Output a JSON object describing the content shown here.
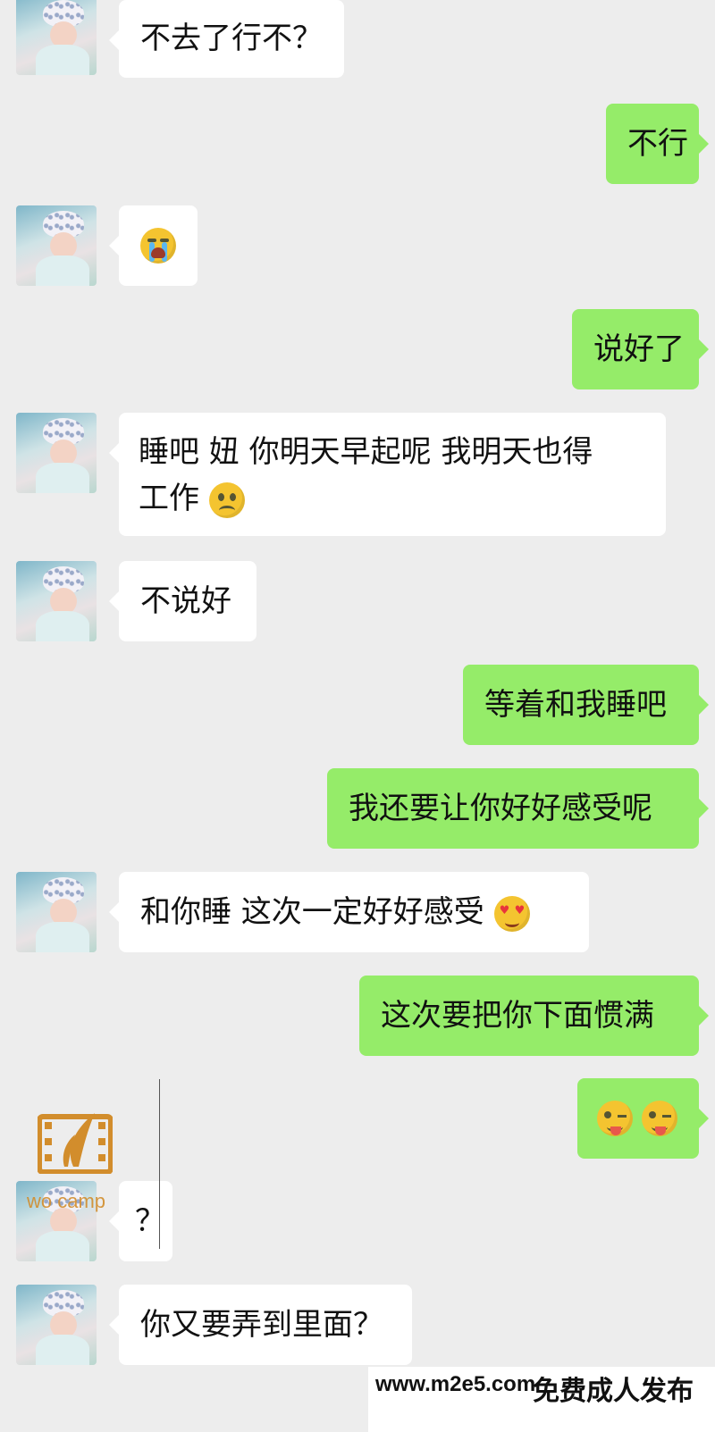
{
  "messages": [
    {
      "side": "in",
      "text": "不去了行不？"
    },
    {
      "side": "out",
      "text": "不行"
    },
    {
      "side": "in",
      "emoji": "crying-emoji"
    },
    {
      "side": "out",
      "text": "说好了"
    },
    {
      "side": "in",
      "text_line1": "睡吧  妞  你明天早起呢  我明天也得",
      "text_line2": "工作",
      "emoji": "sad-emoji"
    },
    {
      "side": "in",
      "text": "不说好"
    },
    {
      "side": "out",
      "text": "等着和我睡吧"
    },
    {
      "side": "out",
      "text": "我还要让你好好感受呢"
    },
    {
      "side": "in",
      "text": "和你睡  这次一定好好感受",
      "emoji": "heart-eyes-emoji"
    },
    {
      "side": "out",
      "text": "这次要把你下面惯满"
    },
    {
      "side": "out",
      "emoji": "tongue-wink-emoji x2"
    },
    {
      "side": "in",
      "text": "？"
    },
    {
      "side": "in",
      "text": "你又要弄到里面？"
    }
  ],
  "watermark": {
    "logo_text": "wo camp",
    "footer_url": "www.m2e5.com",
    "footer_cn": "免费成人发布"
  },
  "colors": {
    "background": "#ededed",
    "incoming_bubble": "#ffffff",
    "outgoing_bubble": "#95ec69"
  }
}
